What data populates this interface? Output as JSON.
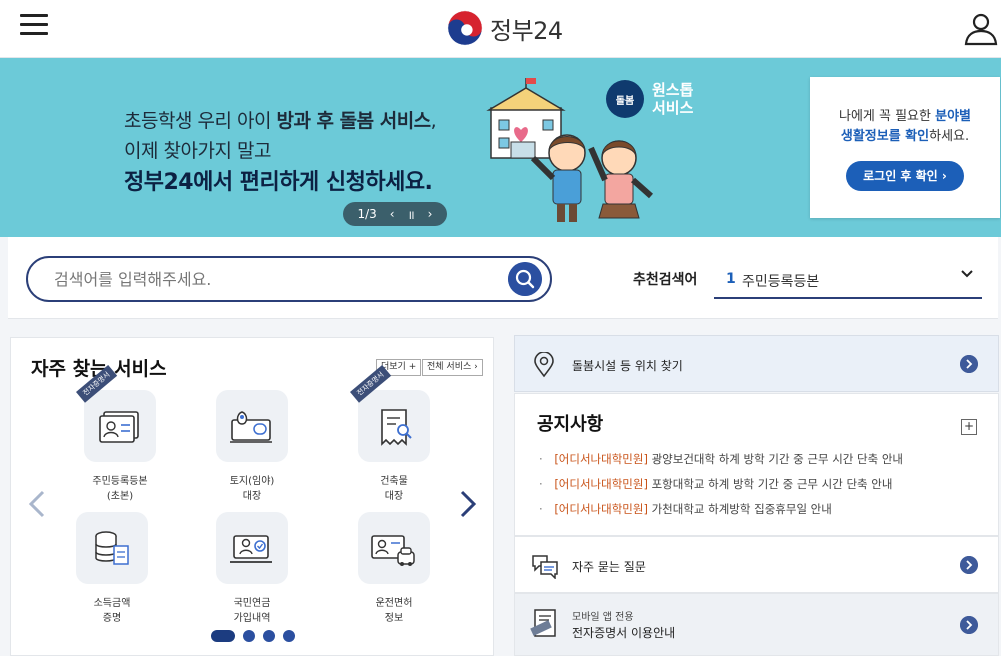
{
  "header": {
    "logo_text": "정부24"
  },
  "banner": {
    "line1_a": "초등학생 우리 아이 ",
    "line1_b": "방과 후 돌봄 서비스",
    "line1_c": ",",
    "line2": "이제 찾아가지 말고",
    "line3": "정부24에서 편리하게 신청하세요.",
    "pager": {
      "label": "1/3",
      "prev": "‹",
      "pause": "॥",
      "next": "›"
    },
    "ones_badge": "돌봄",
    "ones_line1": "원스톱",
    "ones_line2": "서비스"
  },
  "login_card": {
    "msg_a": "나에게 꼭 필요한 ",
    "msg_b": "분야별",
    "msg_c": "생활정보를 확인",
    "msg_d": "하세요.",
    "button": "로그인 후 확인 ›"
  },
  "search": {
    "placeholder": "검색어를 입력해주세요.",
    "rec_label": "추천검색어",
    "rec_num": "1",
    "rec_text": "주민등록등본"
  },
  "services": {
    "title": "자주 찾는 서비스",
    "more": "더보기 +",
    "all": "전체 서비스 ›",
    "ribbon": "전자증명서",
    "items": [
      {
        "line1": "주민등록등본",
        "line2": "(초본)"
      },
      {
        "line1": "토지(임야)",
        "line2": "대장"
      },
      {
        "line1": "건축물",
        "line2": "대장"
      },
      {
        "line1": "소득금액",
        "line2": "증명"
      },
      {
        "line1": "국민연금",
        "line2": "가입내역"
      },
      {
        "line1": "운전면허",
        "line2": "정보"
      }
    ]
  },
  "right": {
    "care": "돌봄시설 등 위치 찾기",
    "notice_title": "공지사항",
    "notice_plus": "+",
    "notices": [
      {
        "tag": "[어디서나대학민원]",
        "text": " 광양보건대학 하계 방학 기간 중 근무 시간 단축 안내"
      },
      {
        "tag": "[어디서나대학민원]",
        "text": " 포항대학교 하계 방학 기간 중 근무 시간 단축 안내"
      },
      {
        "tag": "[어디서나대학민원]",
        "text": " 가천대학교 하계방학 집중휴무일 안내"
      }
    ],
    "faq": "자주 묻는 질문",
    "cert_small": "모바일 앱 전용",
    "cert_main": "전자증명서 이용안내"
  },
  "colors": {
    "banner_bg": "#6ccad8",
    "brand_blue": "#1c5fb8",
    "navy": "#2b3f78"
  }
}
